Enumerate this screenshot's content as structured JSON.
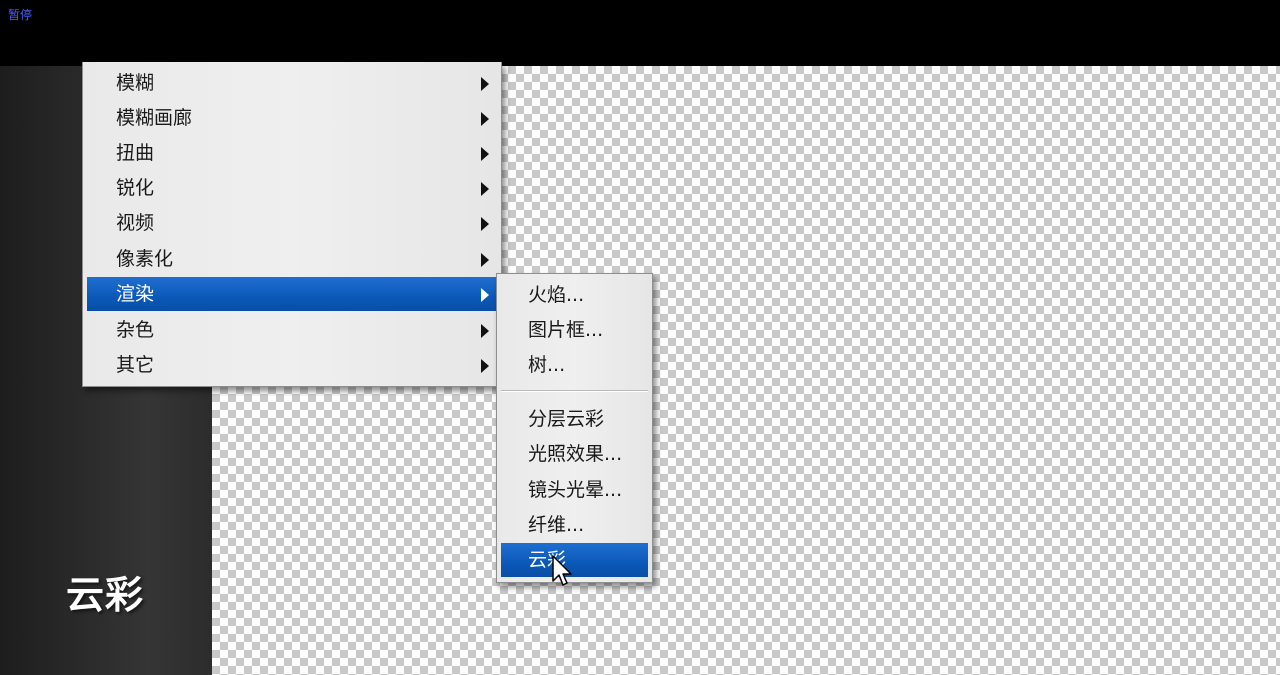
{
  "player": {
    "pause_label": "暂停"
  },
  "caption": "云彩",
  "filter_menu": {
    "items": [
      {
        "label": "模糊",
        "has_submenu": true
      },
      {
        "label": "模糊画廊",
        "has_submenu": true
      },
      {
        "label": "扭曲",
        "has_submenu": true
      },
      {
        "label": "锐化",
        "has_submenu": true
      },
      {
        "label": "视频",
        "has_submenu": true
      },
      {
        "label": "像素化",
        "has_submenu": true
      },
      {
        "label": "渲染",
        "has_submenu": true,
        "active": true
      },
      {
        "label": "杂色",
        "has_submenu": true
      },
      {
        "label": "其它",
        "has_submenu": true
      }
    ]
  },
  "render_submenu": {
    "group1": [
      {
        "label": "火焰..."
      },
      {
        "label": "图片框..."
      },
      {
        "label": "树..."
      }
    ],
    "group2": [
      {
        "label": "分层云彩"
      },
      {
        "label": "光照效果..."
      },
      {
        "label": "镜头光晕..."
      },
      {
        "label": "纤维..."
      },
      {
        "label": "云彩",
        "active": true
      }
    ]
  },
  "colors": {
    "highlight": "#0b58b8",
    "menu_bg": "#ececec",
    "pause_text": "#4a5cff"
  }
}
